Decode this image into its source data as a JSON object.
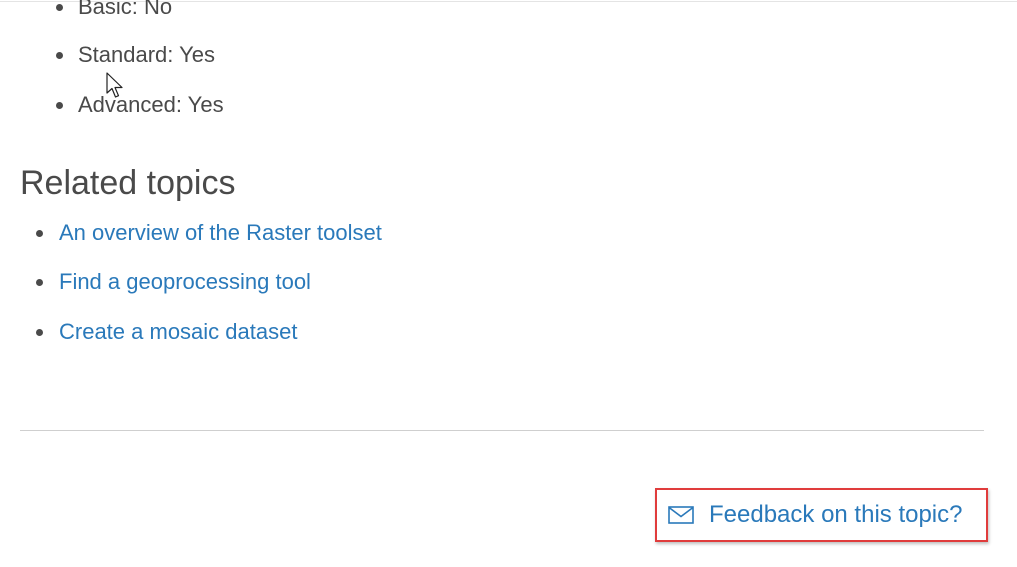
{
  "licensing": {
    "items": [
      {
        "text": "Basic: No"
      },
      {
        "text": "Standard: Yes"
      },
      {
        "text": "Advanced: Yes"
      }
    ]
  },
  "related": {
    "title": "Related topics",
    "links": [
      {
        "label": "An overview of the Raster toolset"
      },
      {
        "label": "Find a geoprocessing tool"
      },
      {
        "label": "Create a mosaic dataset"
      }
    ]
  },
  "feedback": {
    "label": "Feedback on this topic?",
    "icon": "mail-icon",
    "highlight_color": "#e03c3c"
  },
  "colors": {
    "link": "#2a79ba",
    "text": "#4a4a4a"
  }
}
